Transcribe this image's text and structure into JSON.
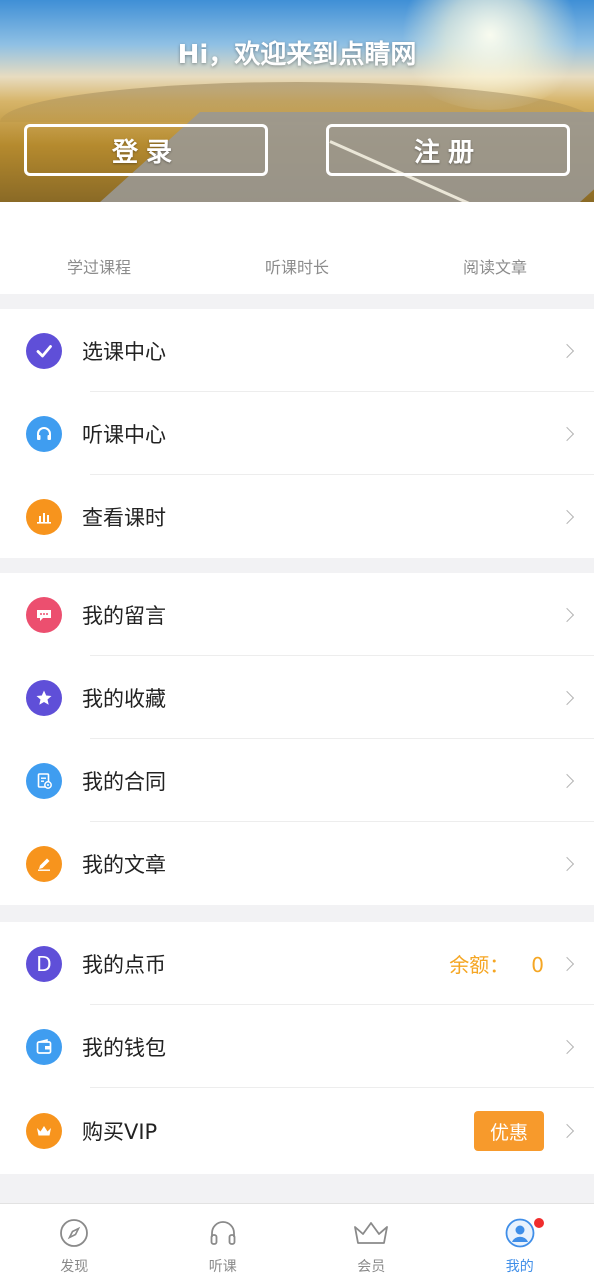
{
  "hero": {
    "welcome": "Hi，欢迎来到点睛网",
    "login_label": "登录",
    "register_label": "注册"
  },
  "stats": [
    {
      "label": "学过课程"
    },
    {
      "label": "听课时长"
    },
    {
      "label": "阅读文章"
    }
  ],
  "groups": [
    {
      "items": [
        {
          "label": "选课中心",
          "icon": "check-icon",
          "color": "#5f4fd8"
        },
        {
          "label": "听课中心",
          "icon": "headphones-icon",
          "color": "#3f9df0"
        },
        {
          "label": "查看课时",
          "icon": "bar-chart-icon",
          "color": "#f7941d"
        }
      ]
    },
    {
      "items": [
        {
          "label": "我的留言",
          "icon": "message-icon",
          "color": "#ec4f6f"
        },
        {
          "label": "我的收藏",
          "icon": "star-icon",
          "color": "#5f4fd8"
        },
        {
          "label": "我的合同",
          "icon": "contract-icon",
          "color": "#3f9df0"
        },
        {
          "label": "我的文章",
          "icon": "pencil-icon",
          "color": "#f7941d"
        }
      ]
    },
    {
      "items": [
        {
          "label": "我的点币",
          "icon": "d-coin-icon",
          "icon_text": "D",
          "color": "#5f4fd8",
          "balance_label": "余额：",
          "balance_value": "0"
        },
        {
          "label": "我的钱包",
          "icon": "wallet-icon",
          "color": "#3f9df0"
        },
        {
          "label": "购买VIP",
          "icon": "crown-icon",
          "color": "#f7941d",
          "badge": "优惠"
        }
      ]
    }
  ],
  "tabbar": [
    {
      "label": "发现",
      "icon": "compass-icon"
    },
    {
      "label": "听课",
      "icon": "headphones-icon"
    },
    {
      "label": "会员",
      "icon": "crown-icon"
    },
    {
      "label": "我的",
      "icon": "user-icon",
      "active": true
    }
  ],
  "colors": {
    "accent_blue": "#3f8ee8",
    "balance_orange": "#f5a623",
    "badge_orange": "#f79a2c",
    "notification_red": "#f02d2d"
  }
}
